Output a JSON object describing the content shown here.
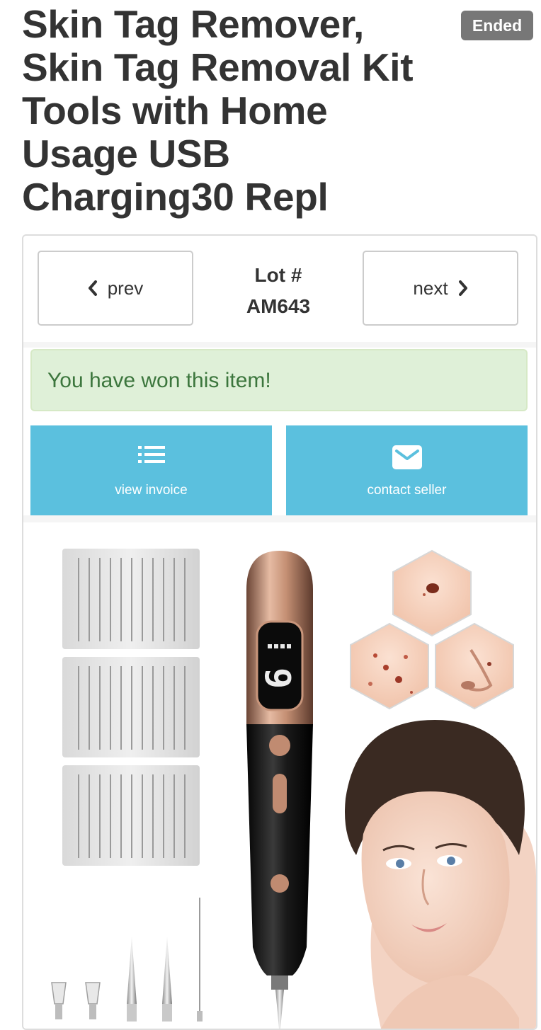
{
  "listing": {
    "title": "Skin Tag Remover, Skin Tag Removal Kit Tools with Home Usage USB Charging30 Repl",
    "status": "Ended"
  },
  "navigation": {
    "prev_label": "prev",
    "next_label": "next",
    "lot_label": "Lot #",
    "lot_number": "AM643"
  },
  "alert": {
    "message": "You have won this item!"
  },
  "actions": {
    "invoice_label": "view invoice",
    "contact_label": "contact seller"
  },
  "product_image": {
    "device_display_digit": "9"
  },
  "colors": {
    "status_badge": "#777777",
    "alert_background": "#dff0d8",
    "alert_text": "#3c763d",
    "action_button": "#5bc0de",
    "title_text": "#333333"
  }
}
